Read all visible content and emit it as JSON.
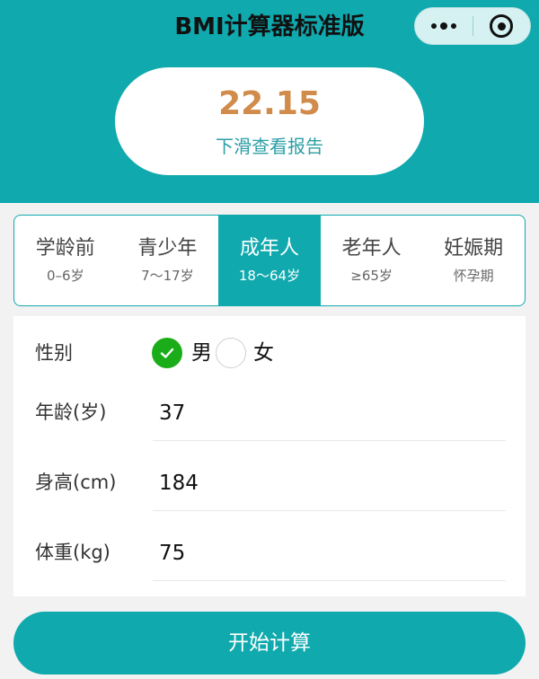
{
  "app": {
    "title": "BMI计算器标准版"
  },
  "capsule": {
    "more_icon": "more-dots-icon",
    "close_icon": "target-close-icon"
  },
  "result": {
    "bmi_value": "22.15",
    "report_link": "下滑查看报告"
  },
  "tabs": [
    {
      "label": "学龄前",
      "range": "0–6岁",
      "active": false
    },
    {
      "label": "青少年",
      "range": "7～17岁",
      "active": false
    },
    {
      "label": "成年人",
      "range": "18～64岁",
      "active": true
    },
    {
      "label": "老年人",
      "range": "≥65岁",
      "active": false
    },
    {
      "label": "妊娠期",
      "range": "怀孕期",
      "active": false
    }
  ],
  "form": {
    "gender": {
      "label": "性别",
      "options": [
        {
          "label": "男",
          "checked": true
        },
        {
          "label": "女",
          "checked": false
        }
      ]
    },
    "age": {
      "label": "年龄(岁)",
      "value": "37"
    },
    "height": {
      "label": "身高(cm)",
      "value": "184"
    },
    "weight": {
      "label": "体重(kg)",
      "value": "75"
    }
  },
  "actions": {
    "calculate_label": "开始计算"
  },
  "colors": {
    "primary": "#10a9ae",
    "result_value": "#d18b4a",
    "check_green": "#1aad19"
  }
}
